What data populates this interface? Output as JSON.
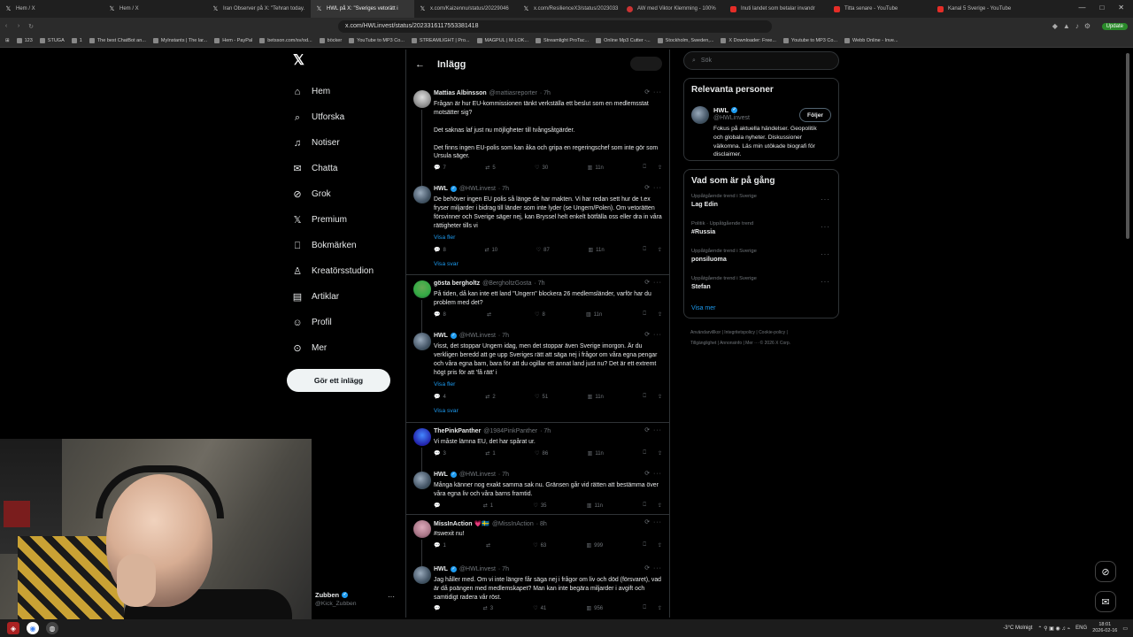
{
  "browser": {
    "tabs": [
      {
        "title": "Hem / X",
        "icon": "X"
      },
      {
        "title": "Hem / X",
        "icon": "X"
      },
      {
        "title": "Iran Observer på X: \"Tehran today.",
        "icon": "X"
      },
      {
        "title": "HWL på X: \"Sveriges vetorätt i",
        "icon": "X",
        "active": true
      },
      {
        "title": "x.com/Kaizennu/status/20229046",
        "icon": "X"
      },
      {
        "title": "x.com/ResilienceX3/status/2023033",
        "icon": "X"
      },
      {
        "title": "AW med Viktor Klemming - 100%",
        "icon": "red"
      },
      {
        "title": "Inuti landet som betalar invandr",
        "icon": "yt"
      },
      {
        "title": "Titta senare - YouTube",
        "icon": "yt"
      },
      {
        "title": "Kanal 5 Sverige - YouTube",
        "icon": "yt"
      }
    ],
    "url": "x.com/HWLinvest/status/2023316117553381418",
    "update_label": "Update",
    "bookmarks": [
      "123",
      "STUGA",
      "1",
      "The best ChatBot an...",
      "MyInstants | The lar...",
      "Hem - PayPal",
      "betsson.com/sv/od...",
      "böcker",
      "YouTube to MP3 Co...",
      "STREAMLIGHT | Pro...",
      "MAGPUL | M-LOK...",
      "Streamlight ProTac...",
      "Online Mp3 Cutter -...",
      "Stockholm, Sweden,...",
      "X Downloader: Free...",
      "Youtube to MP3 Co...",
      "Webb Online - Inve..."
    ]
  },
  "nav": {
    "items": [
      {
        "label": "Hem",
        "icon": "home-icon",
        "glyph": "⌂"
      },
      {
        "label": "Utforska",
        "icon": "search-icon",
        "glyph": "⌕"
      },
      {
        "label": "Notiser",
        "icon": "bell-icon",
        "glyph": "♫"
      },
      {
        "label": "Chatta",
        "icon": "mail-icon",
        "glyph": "✉"
      },
      {
        "label": "Grok",
        "icon": "grok-icon",
        "glyph": "⊘"
      },
      {
        "label": "Premium",
        "icon": "x-icon",
        "glyph": "𝕏"
      },
      {
        "label": "Bokmärken",
        "icon": "bookmark-icon",
        "glyph": "⎕"
      },
      {
        "label": "Kreatörsstudion",
        "icon": "creator-icon",
        "glyph": "♙"
      },
      {
        "label": "Artiklar",
        "icon": "article-icon",
        "glyph": "▤"
      },
      {
        "label": "Profil",
        "icon": "user-icon",
        "glyph": "☺"
      },
      {
        "label": "Mer",
        "icon": "more-icon",
        "glyph": "⊙"
      }
    ],
    "post_button": "Gör ett inlägg"
  },
  "main": {
    "title": "Inlägg",
    "tweets": [
      {
        "name": "Mattias Albinsson",
        "handle": "@mattiasreporter",
        "time": "· 7h",
        "verified": false,
        "text": "Frågan är hur EU-kommissionen tänkt verkställa ett beslut som en medlemsstat motsätter sig?\n\nDet saknas laf just nu möjligheter till tvångsåtgärder.\n\nDet finns ingen EU-polis som kan åka och gripa en regeringschef som inte gör som Ursula säger.",
        "replies": "7",
        "retweets": "5",
        "likes": "30",
        "views": "11n"
      },
      {
        "name": "HWL",
        "handle": "@HWLinvest",
        "time": "· 7h",
        "verified": true,
        "text": "De behöver ingen EU polis så länge de har makten. Vi har redan sett hur de t.ex fryser miljarder i bidrag till länder som inte lyder (se Ungern/Polen). Om vetorätten försvinner och Sverige säger nej, kan Bryssel helt enkelt bötfälla oss eller dra in våra rättigheter tills vi",
        "link": "Visa fler",
        "replies": "8",
        "retweets": "10",
        "likes": "87",
        "views": "11n",
        "show_replies": "Visa svar"
      },
      {
        "name": "gösta bergholtz",
        "handle": "@BergholtzGosta",
        "time": "· 7h",
        "verified": false,
        "text": "På tiden, då kan inte ett land \"Ungern\" blockera 26 medlemsländer, varför har du problem med det?",
        "replies": "8",
        "retweets": "",
        "likes": "8",
        "views": "11n"
      },
      {
        "name": "HWL",
        "handle": "@HWLinvest",
        "time": "· 7h",
        "verified": true,
        "text": "Visst, det stoppar Ungern idag, men det stoppar även Sverige imorgon. Är du verkligen beredd att ge upp Sveriges rätt att säga nej i frågor om våra egna pengar och våra egna barn, bara för att du ogillar ett annat land just nu? Det är ett extremt högt pris för att 'få rätt' i",
        "link": "Visa fler",
        "replies": "4",
        "retweets": "2",
        "likes": "51",
        "views": "11n",
        "show_replies": "Visa svar"
      },
      {
        "name": "ThePinkPanther",
        "handle": "@1984PinkPanther",
        "time": "· 7h",
        "verified": false,
        "text": "Vi måste lämna EU, det har spårat ur.",
        "replies": "3",
        "retweets": "1",
        "likes": "86",
        "views": "11n"
      },
      {
        "name": "HWL",
        "handle": "@HWLinvest",
        "time": "· 7h",
        "verified": true,
        "text": "Många känner nog exakt samma sak nu. Gränsen går vid rätten att bestämma över våra egna liv och våra barns framtid.",
        "replies": "",
        "retweets": "1",
        "likes": "35",
        "views": "11n"
      },
      {
        "name": "MissInAction 💗🇸🇪",
        "handle": "@MissInAction",
        "time": "· 8h",
        "verified": false,
        "text": "#swexit nu!",
        "replies": "1",
        "retweets": "",
        "likes": "63",
        "views": "999"
      },
      {
        "name": "HWL",
        "handle": "@HWLinvest",
        "time": "· 7h",
        "verified": true,
        "text": "Jag håller med. Om vi inte längre får säga nej i frågor om liv och död (försvaret), vad är då poängen med medlemskapet? Man kan inte begära miljarder i avgift och samtidigt radera vår röst.",
        "replies": "",
        "retweets": "3",
        "likes": "41",
        "views": "956"
      }
    ]
  },
  "right": {
    "search_placeholder": "Sök",
    "relevant_title": "Relevanta personer",
    "person": {
      "name": "HWL",
      "handle": "@HWLinvest",
      "follow": "Följer",
      "bio": "Fokus på aktuella händelser. Geopolitik och globala nyheter. Diskussioner välkomna. Läs min utökade biografi för disclaimer."
    },
    "trends_title": "Vad som är på gång",
    "trends": [
      {
        "context": "Uppåtgående trend i Sverige",
        "name": "Lag Edin"
      },
      {
        "context": "Politik · Uppåtgående trend",
        "name": "#Russia"
      },
      {
        "context": "Uppåtgående trend i Sverige",
        "name": "ponsiluoma"
      },
      {
        "context": "Uppåtgående trend i Sverige",
        "name": "Stefan"
      }
    ],
    "show_more": "Visa mer",
    "footer_line1": "Användarvillkor  |  Integritetspolicy  |  Cookie-policy  |",
    "footer_line2": "Tillgänglighet  |  Annonsinfo  |  Mer ···  © 2026 X Corp."
  },
  "account": {
    "name": "Zubben",
    "handle": "@Kick_Zubben"
  },
  "taskbar": {
    "weather": "-3°C  Molnigt",
    "lang": "ENG",
    "time": "18:01",
    "date": "2026-02-16"
  }
}
